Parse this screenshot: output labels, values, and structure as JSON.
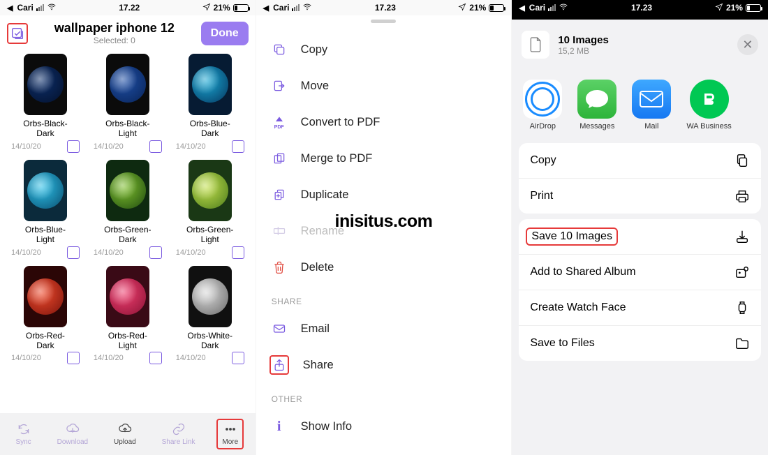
{
  "pane1": {
    "status": {
      "carrier_back": "Cari",
      "time": "17.22",
      "battery": "21%"
    },
    "title": "wallpaper iphone 12",
    "subtitle": "Selected: 0",
    "done": "Done",
    "items": [
      {
        "label": "Orbs-Black-Dark",
        "date": "14/10/20",
        "bg": "#0b0b0b",
        "c1": "#0d2f6b",
        "c2": "#03102a"
      },
      {
        "label": "Orbs-Black-Light",
        "date": "14/10/20",
        "bg": "#0b0b0b",
        "c1": "#1f4fa6",
        "c2": "#082356"
      },
      {
        "label": "Orbs-Blue-Dark",
        "date": "14/10/20",
        "bg": "#061b33",
        "c1": "#1aa9d4",
        "c2": "#05355e"
      },
      {
        "label": "Orbs-Blue-Light",
        "date": "14/10/20",
        "bg": "#0b2a3b",
        "c1": "#2dc0e8",
        "c2": "#0a4d6e"
      },
      {
        "label": "Orbs-Green-Dark",
        "date": "14/10/20",
        "bg": "#0e2a10",
        "c1": "#7fbf2e",
        "c2": "#1f4a10"
      },
      {
        "label": "Orbs-Green-Light",
        "date": "14/10/20",
        "bg": "#1a3815",
        "c1": "#c3e04e",
        "c2": "#4a7a1a"
      },
      {
        "label": "Orbs-Red-Dark",
        "date": "14/10/20",
        "bg": "#2b0606",
        "c1": "#ef4a2c",
        "c2": "#7a140c"
      },
      {
        "label": "Orbs-Red-Light",
        "date": "14/10/20",
        "bg": "#3a0a16",
        "c1": "#ef3e6e",
        "c2": "#8a1336"
      },
      {
        "label": "Orbs-White-Dark",
        "date": "14/10/20",
        "bg": "#101010",
        "c1": "#d9d9d9",
        "c2": "#6a6a6a"
      }
    ],
    "toolbar": {
      "sync": "Sync",
      "download": "Download",
      "upload": "Upload",
      "share": "Share Link",
      "more": "More"
    }
  },
  "pane2": {
    "status": {
      "carrier_back": "Cari",
      "time": "17.23",
      "battery": "21%"
    },
    "menu": {
      "copy": "Copy",
      "move": "Move",
      "pdf": "Convert to PDF",
      "merge": "Merge to PDF",
      "dup": "Duplicate",
      "rename": "Rename",
      "delete": "Delete"
    },
    "section_share": "Share",
    "email": "Email",
    "share": "Share",
    "section_other": "Other",
    "showinfo": "Show Info",
    "pdf_badge": "PDF"
  },
  "pane3": {
    "status": {
      "carrier_back": "Cari",
      "time": "17.23",
      "battery": "21%"
    },
    "header_title": "10 Images",
    "header_sub": "15,2 MB",
    "apps": {
      "airdrop": "AirDrop",
      "messages": "Messages",
      "mail": "Mail",
      "wab": "WA Business"
    },
    "actions1": {
      "copy": "Copy",
      "print": "Print"
    },
    "actions2": {
      "save": "Save 10 Images",
      "album": "Add to Shared Album",
      "watch": "Create Watch Face",
      "files": "Save to Files"
    }
  },
  "watermark": "inisitus.com"
}
